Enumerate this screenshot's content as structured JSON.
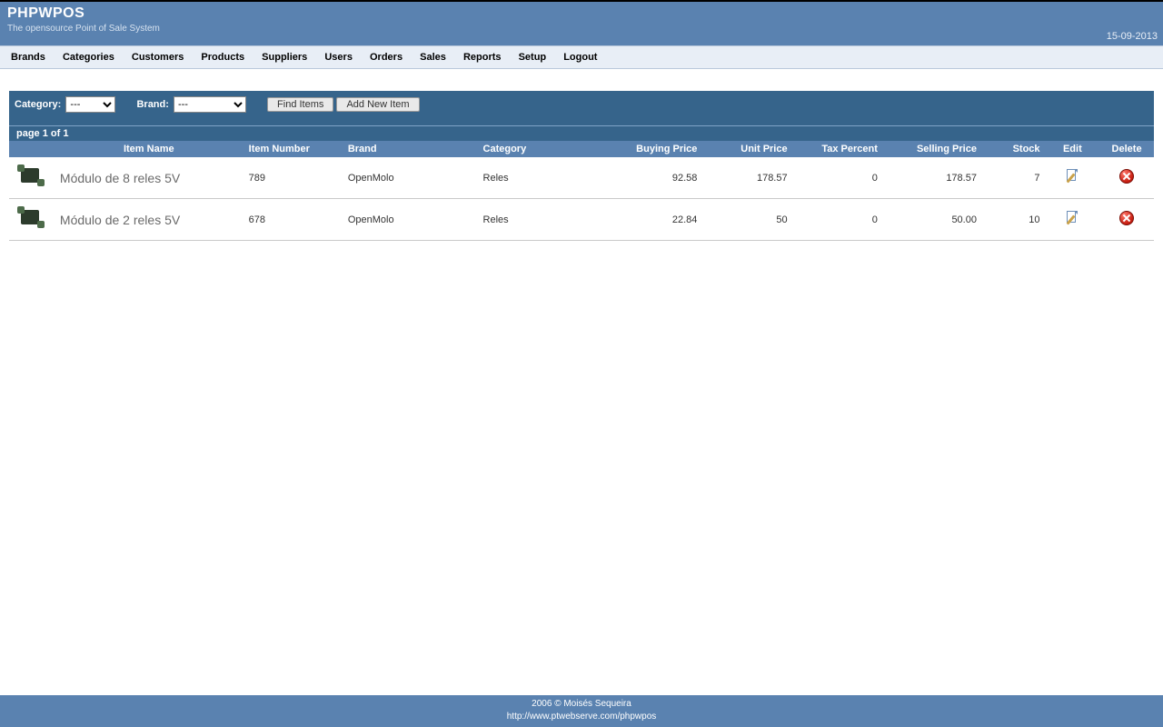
{
  "header": {
    "title": "PHPWPOS",
    "subtitle": "The opensource Point of Sale System",
    "date": "15-09-2013"
  },
  "nav": [
    "Brands",
    "Categories",
    "Customers",
    "Products",
    "Suppliers",
    "Users",
    "Orders",
    "Sales",
    "Reports",
    "Setup",
    "Logout"
  ],
  "filter": {
    "category_label": "Category:",
    "brand_label": "Brand:",
    "category_value": "---",
    "brand_value": "---",
    "find_btn": "Find Items",
    "add_btn": "Add New Item"
  },
  "page_info": "page 1 of 1",
  "columns": [
    "",
    "Item Name",
    "Item Number",
    "Brand",
    "Category",
    "Buying Price",
    "Unit Price",
    "Tax Percent",
    "Selling Price",
    "Stock",
    "Edit",
    "Delete"
  ],
  "rows": [
    {
      "name": "Módulo de 8 reles 5V",
      "item_number": "789",
      "brand": "OpenMolo",
      "category": "Reles",
      "buying_price": "92.58",
      "unit_price": "178.57",
      "tax_percent": "0",
      "selling_price": "178.57",
      "stock": "7"
    },
    {
      "name": "Módulo de 2 reles 5V",
      "item_number": "678",
      "brand": "OpenMolo",
      "category": "Reles",
      "buying_price": "22.84",
      "unit_price": "50",
      "tax_percent": "0",
      "selling_price": "50.00",
      "stock": "10"
    }
  ],
  "footer": {
    "copyright": "2006 © Moisés Sequeira",
    "url": "http://www.ptwebserve.com/phpwpos"
  }
}
